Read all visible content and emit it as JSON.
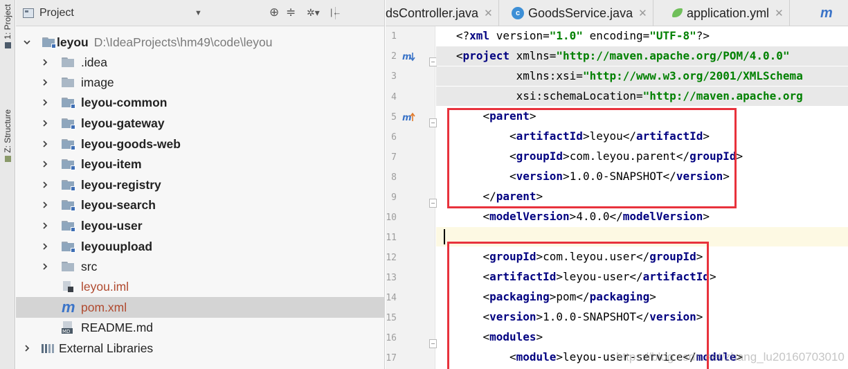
{
  "tool_stripe": {
    "project_tab": "1: Project",
    "structure_tab": "Z: Structure"
  },
  "project_panel": {
    "title": "Project",
    "toolbar": {
      "locate_icon": "⊕",
      "collapse_icon": "≑",
      "settings_icon": "✲▾",
      "hide_icon": "|←"
    },
    "tree": [
      {
        "name": "leyou",
        "path": "D:\\IdeaProjects\\hm49\\code\\leyou",
        "kind": "module",
        "bold": true,
        "expanded": true,
        "depth": 0
      },
      {
        "name": ".idea",
        "kind": "folder",
        "bold": false,
        "depth": 1
      },
      {
        "name": "image",
        "kind": "folder",
        "bold": false,
        "depth": 1
      },
      {
        "name": "leyou-common",
        "kind": "module",
        "bold": true,
        "depth": 1
      },
      {
        "name": "leyou-gateway",
        "kind": "module",
        "bold": true,
        "depth": 1
      },
      {
        "name": "leyou-goods-web",
        "kind": "module",
        "bold": true,
        "depth": 1
      },
      {
        "name": "leyou-item",
        "kind": "module",
        "bold": true,
        "depth": 1
      },
      {
        "name": "leyou-registry",
        "kind": "module",
        "bold": true,
        "depth": 1
      },
      {
        "name": "leyou-search",
        "kind": "module",
        "bold": true,
        "depth": 1
      },
      {
        "name": "leyou-user",
        "kind": "module",
        "bold": true,
        "depth": 1
      },
      {
        "name": "leyouupload",
        "kind": "module",
        "bold": true,
        "depth": 1
      },
      {
        "name": "src",
        "kind": "folder",
        "bold": false,
        "depth": 1
      },
      {
        "name": "leyou.iml",
        "kind": "iml-file",
        "depth": 1
      },
      {
        "name": "pom.xml",
        "kind": "maven-file",
        "depth": 1,
        "selected": true
      },
      {
        "name": "README.md",
        "kind": "md-file",
        "depth": 1
      },
      {
        "name": "External Libraries",
        "kind": "libraries",
        "depth": 0
      }
    ]
  },
  "editor": {
    "tabs": [
      {
        "label": "dsController.java"
      },
      {
        "label": "GoodsService.java"
      },
      {
        "label": "application.yml"
      },
      {
        "label": "m"
      }
    ],
    "line_numbers": [
      "1",
      "2",
      "3",
      "4",
      "5",
      "6",
      "7",
      "8",
      "9",
      "10",
      "11",
      "12",
      "13",
      "14",
      "15",
      "16",
      "17"
    ],
    "lines": [
      "<?xml version=\"1.0\" encoding=\"UTF-8\"?>",
      "<project xmlns=\"http://maven.apache.org/POM/4.0.0\"",
      "         xmlns:xsi=\"http://www.w3.org/2001/XMLSchema",
      "         xsi:schemaLocation=\"http://maven.apache.org",
      "    <parent>",
      "        <artifactId>leyou</artifactId>",
      "        <groupId>com.leyou.parent</groupId>",
      "        <version>1.0.0-SNAPSHOT</version>",
      "    </parent>",
      "    <modelVersion>4.0.0</modelVersion>",
      "",
      "    <groupId>com.leyou.user</groupId>",
      "    <artifactId>leyou-user</artifactId>",
      "    <packaging>pom</packaging>",
      "    <version>1.0.0-SNAPSHOT</version>",
      "    <modules>",
      "        <module>leyou-user-service</module>"
    ],
    "watermark": "https://blog.csdn.net/zhang_lu20160703010"
  }
}
